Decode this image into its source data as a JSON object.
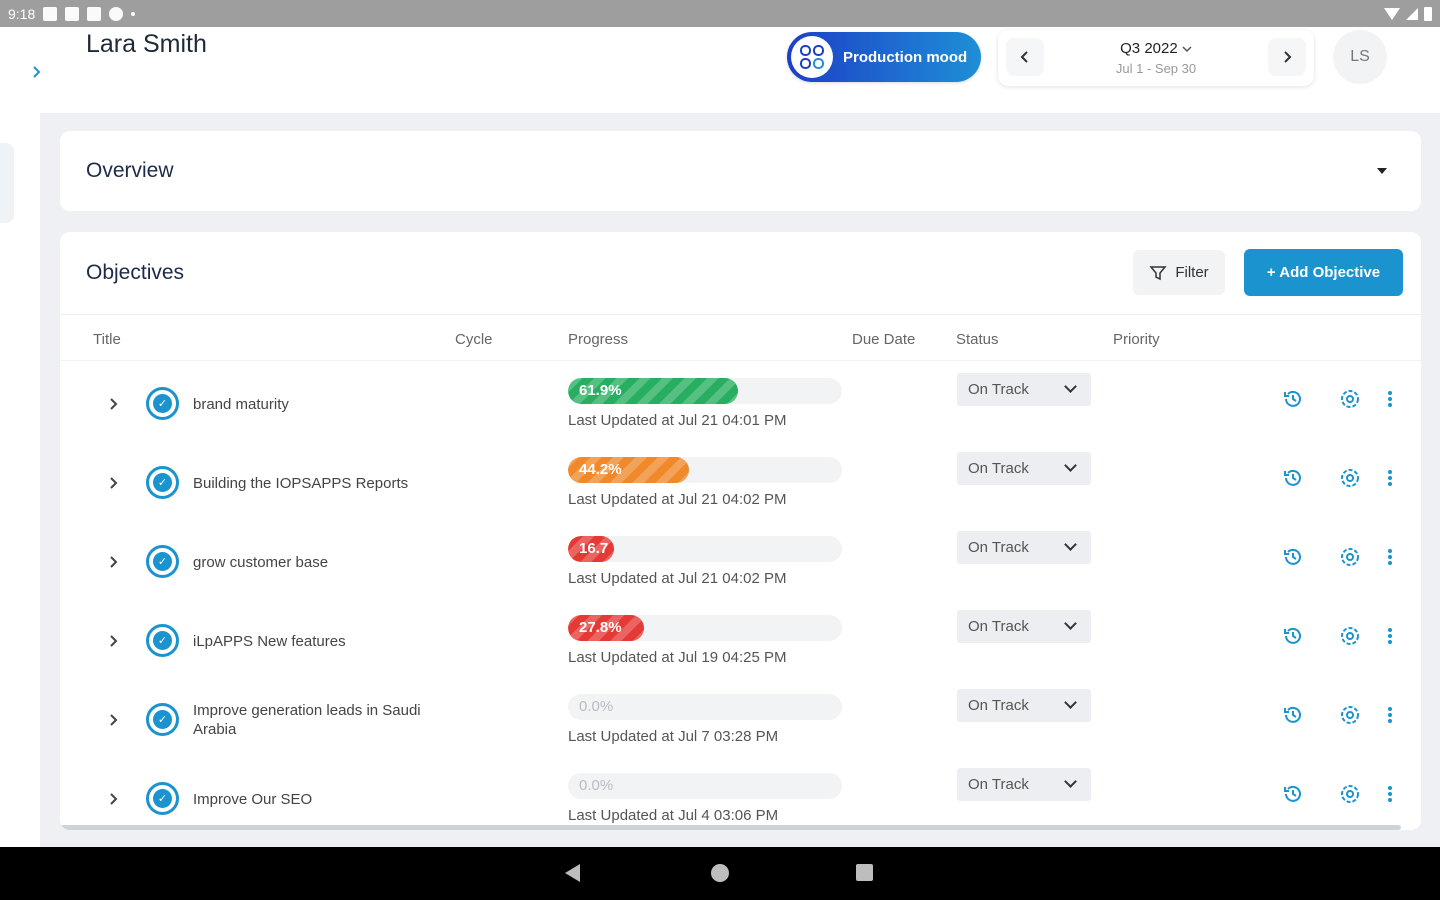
{
  "status_bar": {
    "time": "9:18"
  },
  "header": {
    "user_name": "Lara Smith",
    "mode_label": "Production mood",
    "cycle": {
      "name": "Q3 2022",
      "range": "Jul 1 - Sep 30"
    },
    "avatar_initials": "LS"
  },
  "overview": {
    "title": "Overview"
  },
  "objectives": {
    "title": "Objectives",
    "filter_label": "Filter",
    "add_label": "+ Add Objective",
    "columns": {
      "title": "Title",
      "cycle": "Cycle",
      "progress": "Progress",
      "due_date": "Due Date",
      "status": "Status",
      "priority": "Priority"
    },
    "rows": [
      {
        "title": "brand maturity",
        "progress_text": "61.9%",
        "progress": 61.9,
        "color": "#27ae60",
        "updated": "Last Updated at Jul 21 04:01 PM",
        "status": "On Track"
      },
      {
        "title": "Building the IOPSAPPS Reports",
        "progress_text": "44.2%",
        "progress": 44.2,
        "color": "#f0892a",
        "updated": "Last Updated at Jul 21 04:02 PM",
        "status": "On Track"
      },
      {
        "title": "grow customer base",
        "progress_text": "16.7",
        "progress": 16.7,
        "color": "#e53935",
        "updated": "Last Updated at Jul 21 04:02 PM",
        "status": "On Track"
      },
      {
        "title": "iLpAPPS New features",
        "progress_text": "27.8%",
        "progress": 27.8,
        "color": "#e53935",
        "updated": "Last Updated at Jul 19 04:25 PM",
        "status": "On Track"
      },
      {
        "title": "Improve generation leads in Saudi Arabia",
        "progress_text": "0.0%",
        "progress": 0,
        "color": "#e53935",
        "updated": "Last Updated at Jul 7 03:28 PM",
        "status": "On Track"
      },
      {
        "title": "Improve Our SEO",
        "progress_text": "0.0%",
        "progress": 0,
        "color": "#e53935",
        "updated": "Last Updated at Jul 4 03:06 PM",
        "status": "On Track"
      }
    ]
  },
  "icons": [
    "chevron-right-icon",
    "target-icon",
    "history-icon",
    "settings-icon",
    "more-vertical-icon",
    "filter-icon"
  ]
}
